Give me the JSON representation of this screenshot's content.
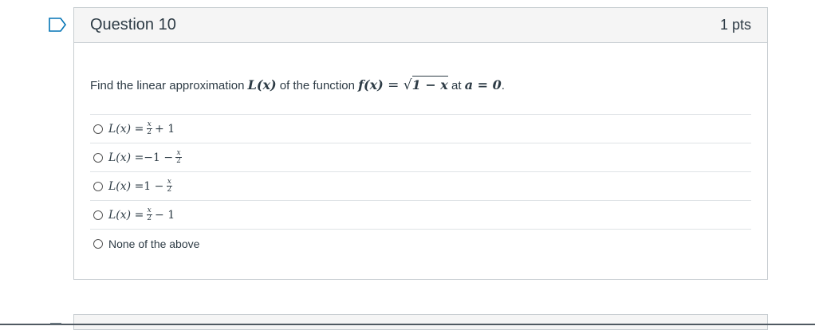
{
  "question": {
    "title": "Question 10",
    "points": "1 pts",
    "prompt_prefix": "Find the linear approximation",
    "prompt_mid1": "of the function",
    "prompt_mid2": "at",
    "prompt_suffix": ".",
    "func_L": "L(x)",
    "func_f": "f(x)",
    "eq": " = ",
    "sqrt_symbol": "√",
    "sqrt_content": "1 − x",
    "a_eq": "a = 0",
    "answers": [
      {
        "lhs": "L(x) = ",
        "pre": "",
        "num": "x",
        "den": "2",
        "post": "+ 1"
      },
      {
        "lhs": "L(x) = ",
        "pre": "−1 − ",
        "num": "x",
        "den": "2",
        "post": ""
      },
      {
        "lhs": "L(x) = ",
        "pre": "1 − ",
        "num": "x",
        "den": "2",
        "post": ""
      },
      {
        "lhs": "L(x) = ",
        "pre": "",
        "num": "x",
        "den": "2",
        "post": "− 1"
      },
      {
        "text": "None of the above"
      }
    ]
  },
  "colors": {
    "border": "#c7cdd1",
    "header_bg": "#f5f5f5",
    "flag": "#0374b5",
    "text": "#2d3b45"
  },
  "icons": {
    "flag": "bookmark-flag-icon",
    "radio": "radio-button-icon"
  }
}
